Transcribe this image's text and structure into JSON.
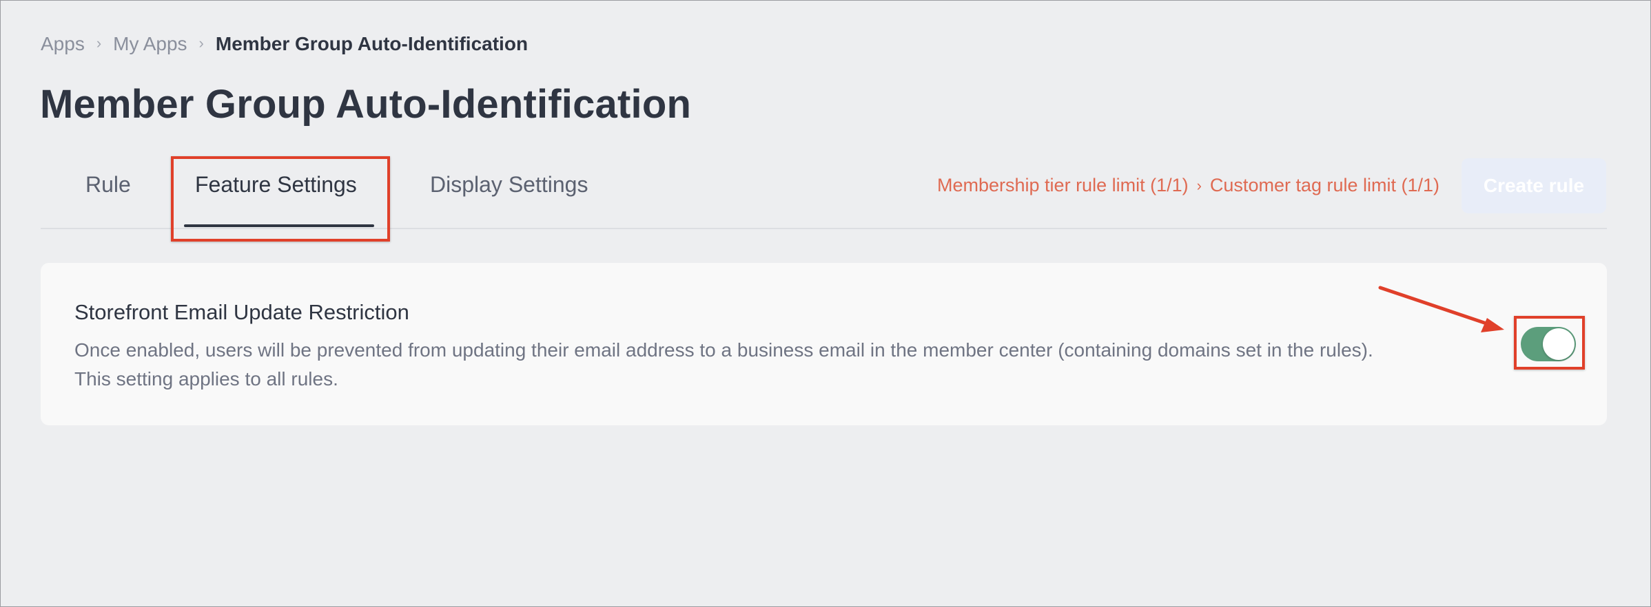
{
  "breadcrumb": {
    "items": [
      "Apps",
      "My Apps"
    ],
    "current": "Member Group Auto-Identification",
    "separator": "›"
  },
  "page_title": "Member Group Auto-Identification",
  "tabs": [
    {
      "label": "Rule",
      "active": false
    },
    {
      "label": "Feature Settings",
      "active": true
    },
    {
      "label": "Display Settings",
      "active": false
    }
  ],
  "limits": {
    "membership_tier": "Membership tier rule limit (1/1)",
    "separator": "›",
    "customer_tag": "Customer tag rule limit (1/1)"
  },
  "create_rule_button": {
    "label": "Create rule",
    "disabled": true
  },
  "setting": {
    "title": "Storefront Email Update Restriction",
    "description_line1": "Once enabled, users will be prevented from updating their email address to a business email in the member center (containing domains set in the rules).",
    "description_line2": "This setting applies to all rules.",
    "enabled": true
  },
  "colors": {
    "background": "#edeef0",
    "card": "#f9f9f9",
    "text_primary": "#2f3542",
    "text_secondary": "#6f7483",
    "limit_text": "#df6a52",
    "toggle_on": "#5c9e7c",
    "annotation_red": "#e0402a",
    "button_disabled": "#e8edf8"
  },
  "annotations": {
    "highlight_targets": [
      "tab-feature-settings",
      "email-restriction-toggle"
    ],
    "arrow_target": "email-restriction-toggle"
  }
}
